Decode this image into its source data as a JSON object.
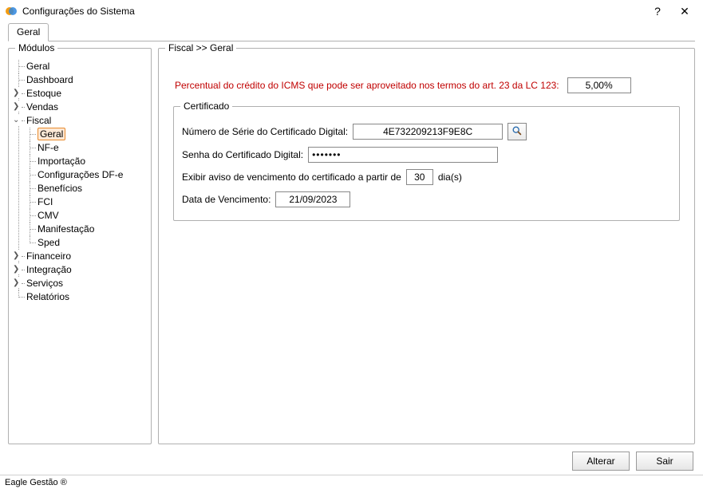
{
  "window": {
    "title": "Configurações do Sistema",
    "help_symbol": "?",
    "close_symbol": "✕"
  },
  "tabs": {
    "active": "Geral"
  },
  "sidebar": {
    "title": "Módulos",
    "items": {
      "geral": "Geral",
      "dashboard": "Dashboard",
      "estoque": "Estoque",
      "vendas": "Vendas",
      "fiscal": "Fiscal",
      "fiscal_children": {
        "geral": "Geral",
        "nfe": "NF-e",
        "importacao": "Importação",
        "config_dfe": "Configurações DF-e",
        "beneficios": "Benefícios",
        "fci": "FCI",
        "cmv": "CMV",
        "manifestacao": "Manifestação",
        "sped": "Sped"
      },
      "financeiro": "Financeiro",
      "integracao": "Integração",
      "servicos": "Serviços",
      "relatorios": "Relatórios"
    }
  },
  "main": {
    "breadcrumb": "Fiscal >> Geral",
    "percentual_label": "Percentual do crédito do ICMS que pode ser aproveitado nos termos do art. 23 da LC 123:",
    "percentual_value": "5,00%",
    "cert": {
      "legend": "Certificado",
      "serial_label": "Número de Série do Certificado Digital:",
      "serial_value": "4E732209213F9E8C",
      "password_label": "Senha do Certificado Digital:",
      "password_value": "•••••••",
      "expire_label_pre": "Exibir aviso de vencimento do certificado a partir de",
      "expire_days": "30",
      "expire_label_post": "dia(s)",
      "due_label": "Data de Vencimento:",
      "due_value": "21/09/2023"
    }
  },
  "buttons": {
    "alterar": "Alterar",
    "sair": "Sair"
  },
  "status": "Eagle Gestão ®"
}
